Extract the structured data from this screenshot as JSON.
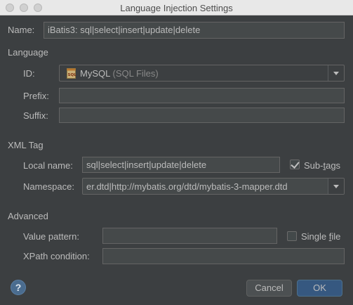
{
  "window": {
    "title": "Language Injection Settings"
  },
  "name": {
    "label": "Name:",
    "value": "iBatis3: sql|select|insert|update|delete"
  },
  "language": {
    "section_title": "Language",
    "id_label": "ID:",
    "id_value": "MySQL",
    "id_suffix": "(SQL Files)",
    "id_icon": "sql-file-icon",
    "prefix_label": "Prefix:",
    "prefix_value": "",
    "suffix_label": "Suffix:",
    "suffix_value": ""
  },
  "xml_tag": {
    "section_title": "XML Tag",
    "local_name_label": "Local name:",
    "local_name_value": "sql|select|insert|update|delete",
    "subtags_label_pre": "Sub-",
    "subtags_label_mn": "t",
    "subtags_label_post": "ags",
    "subtags_checked": true,
    "namespace_label": "Namespace:",
    "namespace_value": "er.dtd|http://mybatis.org/dtd/mybatis-3-mapper.dtd"
  },
  "advanced": {
    "section_title": "Advanced",
    "value_pattern_label": "Value pattern:",
    "value_pattern_value": "",
    "single_file_label_pre": "Single ",
    "single_file_label_mn": "f",
    "single_file_label_post": "ile",
    "single_file_checked": false,
    "xpath_label": "XPath condition:",
    "xpath_value": ""
  },
  "buttons": {
    "help_label": "?",
    "cancel_label": "Cancel",
    "ok_label": "OK"
  },
  "colors": {
    "background": "#3c3f41",
    "field_bg": "#45494a",
    "ok_button": "#365880",
    "help_icon": "#4a6c8f"
  }
}
